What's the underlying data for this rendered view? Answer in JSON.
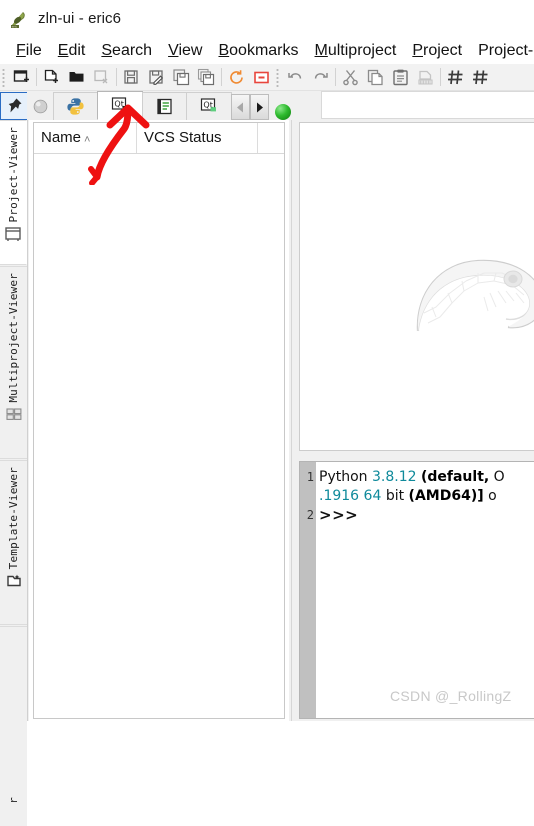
{
  "window": {
    "title": "zln-ui - eric6",
    "app_icon": "eric-quill-icon"
  },
  "menubar": {
    "items": [
      {
        "label": "File",
        "accel": "F"
      },
      {
        "label": "Edit",
        "accel": "E"
      },
      {
        "label": "Search",
        "accel": "S"
      },
      {
        "label": "View",
        "accel": "V"
      },
      {
        "label": "Bookmarks",
        "accel": "B"
      },
      {
        "label": "Multiproject",
        "accel": "M"
      },
      {
        "label": "Project",
        "accel": "P"
      },
      {
        "label": "Project-",
        "accel": ""
      }
    ]
  },
  "toolbar": {
    "buttons": [
      {
        "name": "new-window-icon",
        "label": "New Window"
      },
      {
        "name": "new-file-icon",
        "label": "New File"
      },
      {
        "name": "open-folder-icon",
        "label": "Open"
      },
      {
        "name": "close-file-icon",
        "label": "Close"
      },
      {
        "name": "save-icon",
        "label": "Save"
      },
      {
        "name": "save-as-icon",
        "label": "Save As"
      },
      {
        "name": "save-copy-icon",
        "label": "Save Copy"
      },
      {
        "name": "save-all-icon",
        "label": "Save All"
      },
      {
        "name": "reload-icon",
        "label": "Reload"
      },
      {
        "name": "close-project-icon",
        "label": "Close Project"
      },
      {
        "name": "undo-icon",
        "label": "Undo"
      },
      {
        "name": "redo-icon",
        "label": "Redo"
      },
      {
        "name": "cut-icon",
        "label": "Cut"
      },
      {
        "name": "copy-icon",
        "label": "Copy"
      },
      {
        "name": "paste-icon",
        "label": "Paste"
      },
      {
        "name": "clear-icon",
        "label": "Clear"
      },
      {
        "name": "comment-icon",
        "label": "Comment"
      },
      {
        "name": "uncomment-icon",
        "label": "Uncomment"
      }
    ],
    "colors": {
      "reload": "#f08a32",
      "close_project": "#e8453c"
    }
  },
  "viewer_tabs": {
    "items": [
      {
        "name": "pin-icon",
        "label": "Pin",
        "state": "pinned"
      },
      {
        "name": "sphere-icon",
        "label": "Globals",
        "state": "plain"
      },
      {
        "name": "python-icon",
        "label": "Python Files",
        "state": "normal"
      },
      {
        "name": "qt-forms-icon",
        "label": "Forms",
        "state": "active"
      },
      {
        "name": "resources-icon",
        "label": "Resources",
        "state": "normal"
      },
      {
        "name": "qt-translations-icon",
        "label": "Translations",
        "state": "normal"
      }
    ],
    "scroll_left": "◀",
    "scroll_right": "▶",
    "status_indicator": "green-status-dot"
  },
  "dock_rail": {
    "tabs": [
      {
        "label": "Project-Viewer",
        "icon": "window-icon",
        "selected": true
      },
      {
        "label": "Multiproject-Viewer",
        "icon": "grid-icon",
        "selected": false
      },
      {
        "label": "Template-Viewer",
        "icon": "template-icon",
        "selected": false
      },
      {
        "label": "r",
        "icon": "",
        "selected": false
      }
    ]
  },
  "project_viewer": {
    "columns": [
      {
        "label": "Name",
        "sorted": "ascending",
        "caret": "˄"
      },
      {
        "label": "VCS Status",
        "sorted": "",
        "caret": ""
      }
    ],
    "rows": []
  },
  "editor": {
    "background_logo": "python-snake-watermark"
  },
  "shell": {
    "lines": [
      {
        "number": "1",
        "segments": [
          {
            "text": "Python ",
            "style": "plain"
          },
          {
            "text": "3.8.12",
            "style": "number"
          },
          {
            "text": " ",
            "style": "plain"
          },
          {
            "text": "(default,",
            "style": "bold"
          },
          {
            "text": " O",
            "style": "plain"
          }
        ]
      },
      {
        "number": "",
        "segments": [
          {
            "text": ".1916",
            "style": "number"
          },
          {
            "text": " ",
            "style": "plain"
          },
          {
            "text": "64",
            "style": "number"
          },
          {
            "text": " bit ",
            "style": "plain"
          },
          {
            "text": "(AMD64)]",
            "style": "bold"
          },
          {
            "text": " o",
            "style": "plain"
          }
        ]
      },
      {
        "number": "2",
        "segments": [
          {
            "text": ">>>",
            "style": "prompt"
          }
        ]
      }
    ]
  },
  "watermark": {
    "text": "CSDN @_RollingZ"
  },
  "annotation": {
    "type": "red-arrow",
    "color": "#ee1111",
    "points_at": "qt-forms-tab"
  }
}
